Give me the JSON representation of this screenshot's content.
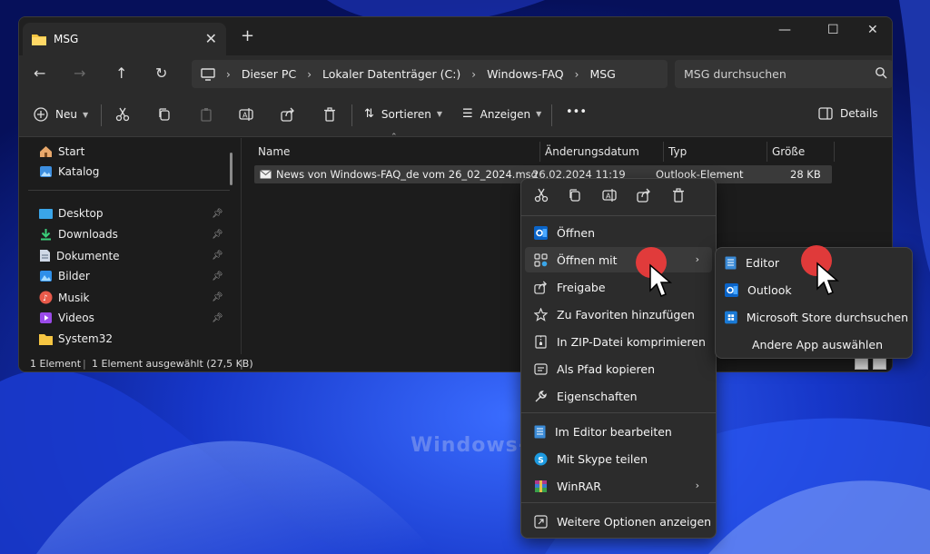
{
  "window": {
    "tab_title": "MSG",
    "tab_close": "✕",
    "new_tab": "+",
    "controls": [
      "—",
      "☐",
      "✕"
    ]
  },
  "nav": {
    "back": "←",
    "forward": "→",
    "up": "↑",
    "refresh": "↻",
    "breadcrumb": [
      "Dieser PC",
      "Lokaler Datenträger (C:)",
      "Windows-FAQ",
      "MSG"
    ],
    "breadcrumb_sep": "›",
    "search_placeholder": "MSG durchsuchen"
  },
  "toolbar": {
    "new_label": "Neu",
    "sort_label": "Sortieren",
    "view_label": "Anzeigen",
    "more_label": "•••",
    "details_label": "Details"
  },
  "sidebar": {
    "items": [
      {
        "label": "Start",
        "icon": "home-icon"
      },
      {
        "label": "Katalog",
        "icon": "gallery-icon"
      },
      {
        "label": "Desktop",
        "icon": "desktop-icon",
        "pinned": true
      },
      {
        "label": "Downloads",
        "icon": "download-icon",
        "pinned": true
      },
      {
        "label": "Dokumente",
        "icon": "document-icon",
        "pinned": true
      },
      {
        "label": "Bilder",
        "icon": "pictures-icon",
        "pinned": true
      },
      {
        "label": "Musik",
        "icon": "music-icon",
        "pinned": true
      },
      {
        "label": "Videos",
        "icon": "video-icon",
        "pinned": true
      },
      {
        "label": "System32",
        "icon": "folder-icon"
      }
    ]
  },
  "columns": {
    "name": "Name",
    "date": "Änderungsdatum",
    "type": "Typ",
    "size": "Größe"
  },
  "file": {
    "name": "News von Windows-FAQ_de vom 26_02_2024.msg",
    "date": "26.02.2024 11:19",
    "type": "Outlook-Element",
    "size": "28 KB"
  },
  "status": {
    "count": "1 Element",
    "selected": "1 Element ausgewählt (27,5 KB)"
  },
  "context_menu": {
    "items": [
      {
        "label": "Öffnen",
        "icon": "outlook-icon"
      },
      {
        "label": "Öffnen mit",
        "icon": "open-with-icon",
        "submenu": true
      },
      {
        "label": "Freigabe",
        "icon": "share-icon"
      },
      {
        "label": "Zu Favoriten hinzufügen",
        "icon": "star-icon"
      },
      {
        "label": "In ZIP-Datei komprimieren",
        "icon": "zip-icon"
      },
      {
        "label": "Als Pfad kopieren",
        "icon": "copy-path-icon"
      },
      {
        "label": "Eigenschaften",
        "icon": "wrench-icon"
      },
      {
        "label": "Im Editor bearbeiten",
        "icon": "notepad-icon"
      },
      {
        "label": "Mit Skype teilen",
        "icon": "skype-icon"
      },
      {
        "label": "WinRAR",
        "icon": "winrar-icon",
        "submenu": true
      },
      {
        "label": "Weitere Optionen anzeigen",
        "icon": "more-options-icon"
      }
    ],
    "submenu_arrow": "›"
  },
  "open_with": {
    "items": [
      {
        "label": "Editor",
        "icon": "notepad-icon"
      },
      {
        "label": "Outlook",
        "icon": "outlook-icon"
      },
      {
        "label": "Microsoft Store durchsuchen",
        "icon": "store-icon"
      },
      {
        "label": "Andere App auswählen"
      }
    ]
  },
  "watermark": "Windows-FAQ",
  "colors": {
    "accent": "#60cdff",
    "menu_bg": "#2c2c2c",
    "window_bg": "#1c1c1c",
    "click_marker": "#f03c3c"
  }
}
